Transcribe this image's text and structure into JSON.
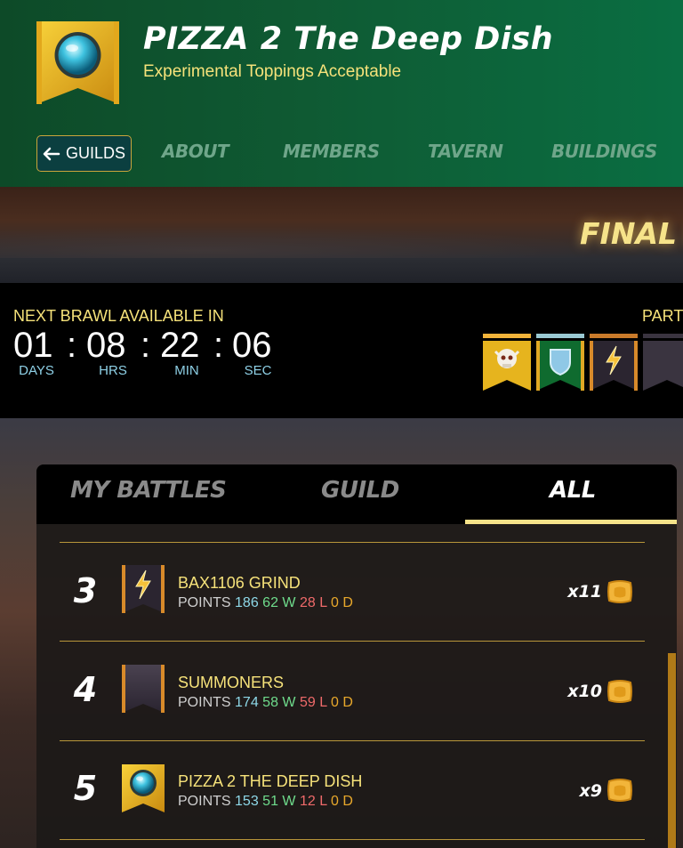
{
  "colors": {
    "header_green": "#0f5a33",
    "accent_gold": "#f6e27a",
    "nav_inactive": "#6fa68a",
    "timer_unit": "#8ed0e6",
    "points": "#8ed8e8",
    "wins": "#6fdc8c",
    "losses": "#ef6a6a",
    "draws": "#e8a82b"
  },
  "header": {
    "title": "PIZZA 2 The Deep Dish",
    "subtitle": "Experimental Toppings Acceptable",
    "banner_icon": "blue-orb-icon",
    "back_button": "GUILDS",
    "nav": [
      "ABOUT",
      "MEMBERS",
      "TAVERN",
      "BUILDINGS"
    ]
  },
  "hero": {
    "final_text": "FINAL F"
  },
  "timer": {
    "label": "NEXT BRAWL AVAILABLE IN",
    "participants_label": "PART",
    "days": "01",
    "hours": "08",
    "minutes": "22",
    "seconds": "06",
    "unit_days": "DAYS",
    "unit_hours": "HRS",
    "unit_minutes": "MIN",
    "unit_seconds": "SEC",
    "separator": ":",
    "participant_icons": [
      "skull-icon",
      "shield-icon",
      "lightning-icon",
      "blank-banner-icon"
    ]
  },
  "panel": {
    "tabs": [
      "MY BATTLES",
      "GUILD",
      "ALL"
    ],
    "active_tab": "ALL",
    "rows": [
      {
        "rank": "3",
        "icon": "lightning-icon",
        "name": "BAX1106 GRIND",
        "points_label": "POINTS",
        "points": "186",
        "wins": "62 W",
        "losses": "28 L",
        "draws": "0 D",
        "multiplier": "x11",
        "reward_icon": "merit-coin-icon"
      },
      {
        "rank": "4",
        "icon": "blank-banner-icon",
        "name": "SUMMONERS",
        "points_label": "POINTS",
        "points": "174",
        "wins": "58 W",
        "losses": "59 L",
        "draws": "0 D",
        "multiplier": "x10",
        "reward_icon": "merit-coin-icon"
      },
      {
        "rank": "5",
        "icon": "blue-orb-icon",
        "name": "PIZZA 2 THE DEEP DISH",
        "points_label": "POINTS",
        "points": "153",
        "wins": "51 W",
        "losses": "12 L",
        "draws": "0 D",
        "multiplier": "x9",
        "reward_icon": "merit-coin-icon"
      }
    ]
  }
}
